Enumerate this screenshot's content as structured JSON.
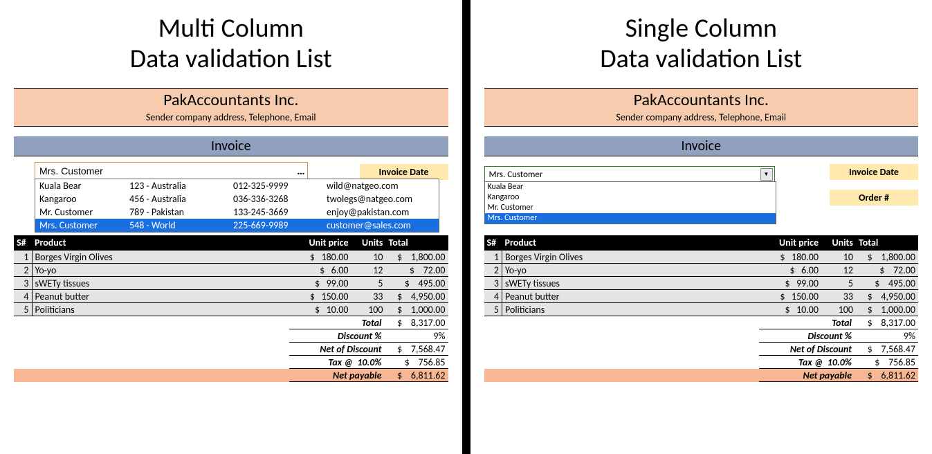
{
  "left": {
    "title_l1": "Multi Column",
    "title_l2": "Data validation List"
  },
  "right": {
    "title_l1": "Single Column",
    "title_l2": "Data validation List"
  },
  "company": {
    "name": "PakAccountants Inc.",
    "address": "Sender company address, Telephone, Email"
  },
  "invoice_label": "Invoice",
  "invoice_date_label": "Invoice Date",
  "order_num_label": "Order #",
  "combo_multi": {
    "value": "Mrs. Customer",
    "rows": [
      {
        "c1": "Kuala Bear",
        "c2": "123 - Australia",
        "c3": "012-325-9999",
        "c4": "wild@natgeo.com",
        "sel": false
      },
      {
        "c1": "Kangaroo",
        "c2": "456 - Australia",
        "c3": "036-336-3268",
        "c4": "twolegs@natgeo.com",
        "sel": false
      },
      {
        "c1": "Mr. Customer",
        "c2": "789 - Pakistan",
        "c3": "133-245-3669",
        "c4": "enjoy@pakistan.com",
        "sel": false
      },
      {
        "c1": "Mrs. Customer",
        "c2": "548 - World",
        "c3": "225-669-9989",
        "c4": "customer@sales.com",
        "sel": true
      }
    ]
  },
  "combo_single": {
    "value": "Mrs. Customer",
    "rows": [
      {
        "c1": "Kuala Bear",
        "sel": false
      },
      {
        "c1": "Kangaroo",
        "sel": false
      },
      {
        "c1": "Mr. Customer",
        "sel": false
      },
      {
        "c1": "Mrs. Customer",
        "sel": true
      }
    ]
  },
  "headers": {
    "sn": "S#",
    "product": "Product",
    "unit_price": "Unit price",
    "units": "Units",
    "total": "Total"
  },
  "lines": [
    {
      "sn": "1",
      "product": "Borges Virgin Olives",
      "price": "180.00",
      "units": "10",
      "total": "1,800.00"
    },
    {
      "sn": "2",
      "product": "Yo-yo",
      "price": "6.00",
      "units": "12",
      "total": "72.00"
    },
    {
      "sn": "3",
      "product": "sWETy tissues",
      "price": "99.00",
      "units": "5",
      "total": "495.00"
    },
    {
      "sn": "4",
      "product": "Peanut butter",
      "price": "150.00",
      "units": "33",
      "total": "4,950.00"
    },
    {
      "sn": "5",
      "product": "Politicians",
      "price": "10.00",
      "units": "100",
      "total": "1,000.00"
    }
  ],
  "summary": {
    "total_label": "Total",
    "total": "8,317.00",
    "discount_label": "Discount %",
    "discount_pct": "9%",
    "netdisc_label": "Net of Discount",
    "netdisc": "7,568.47",
    "tax_label": "Tax @",
    "tax_rate": "10.0%",
    "tax": "756.85",
    "netpay_label": "Net payable",
    "netpay": "6,811.62"
  },
  "currency": "$"
}
